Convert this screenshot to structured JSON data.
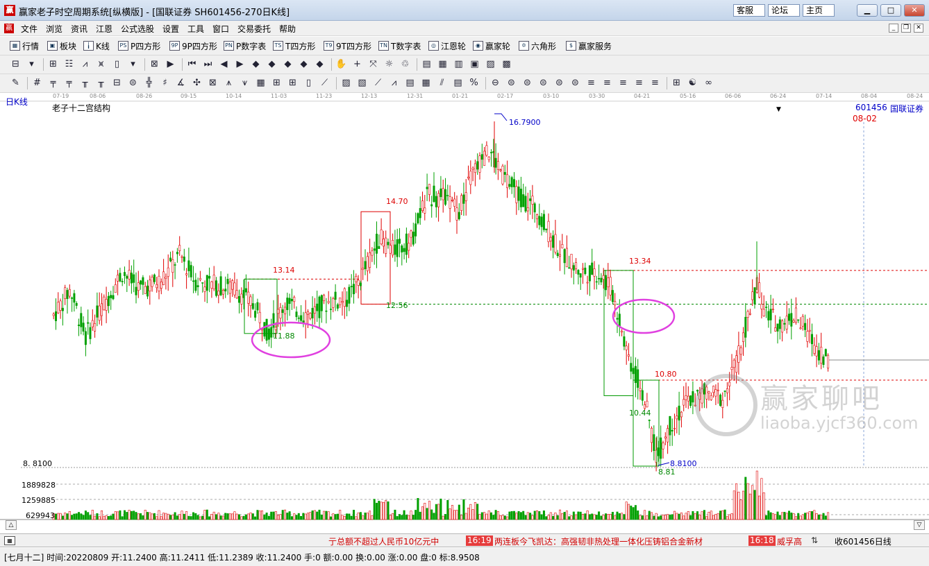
{
  "window": {
    "title": "赢家老子时空周期系统[纵横版] - [国联证券  SH601456-270日K线]",
    "links": [
      "客服",
      "论坛",
      "主页"
    ]
  },
  "menu": [
    "文件",
    "浏览",
    "资讯",
    "江恩",
    "公式选股",
    "设置",
    "工具",
    "窗口",
    "交易委托",
    "帮助"
  ],
  "toolbar1": [
    {
      "icon": "grid-icon",
      "glyph": "▦",
      "label": "行情"
    },
    {
      "icon": "blocks-icon",
      "glyph": "▣",
      "label": "板块"
    },
    {
      "icon": "candle-icon",
      "glyph": "╽",
      "label": "K线"
    },
    {
      "icon": "ps-icon",
      "glyph": "PS",
      "label": "P四方形"
    },
    {
      "icon": "9p-icon",
      "glyph": "9P",
      "label": "9P四方形"
    },
    {
      "icon": "pn-icon",
      "glyph": "PN",
      "label": "P数字表"
    },
    {
      "icon": "ts-icon",
      "glyph": "TS",
      "label": "T四方形"
    },
    {
      "icon": "9t-icon",
      "glyph": "T9",
      "label": "9T四方形"
    },
    {
      "icon": "tn-icon",
      "glyph": "TN",
      "label": "T数字表"
    },
    {
      "icon": "gann-wheel-icon",
      "glyph": "◎",
      "label": "江恩轮"
    },
    {
      "icon": "win-wheel-icon",
      "glyph": "◉",
      "label": "赢家轮"
    },
    {
      "icon": "hexagon-icon",
      "glyph": "✡",
      "label": "六角形"
    },
    {
      "icon": "dollar-icon",
      "glyph": "$",
      "label": "赢家服务"
    }
  ],
  "chart": {
    "period_label": "日K线",
    "indicator_name": "老子十二宫结构",
    "code": "601456",
    "name": "国联证券",
    "marker_date": "08-02",
    "date_ticks": [
      "07-19",
      "08-06",
      "08-26",
      "09-15",
      "10-14",
      "11-03",
      "11-23",
      "12-13",
      "12-31",
      "01-21",
      "02-17",
      "03-10",
      "03-30",
      "04-21",
      "05-16",
      "06-06",
      "06-24",
      "07-14",
      "08-04",
      "08-24"
    ],
    "high_label": "16.7900",
    "low_label": "8.8100",
    "low_axis_label": "8. 8100",
    "levels": [
      "14.70",
      "13.14",
      "13.34",
      "12.56",
      "11.88",
      "10.80",
      "10.44",
      "8.81"
    ],
    "volume_axis": [
      "1889828",
      "1259885",
      "629943"
    ],
    "watermark": {
      "cn": "赢家聊吧",
      "url": "liaoba.yjcf360.com"
    }
  },
  "chart_data": {
    "type": "candlestick",
    "title": "老子十二宫结构",
    "high": 16.79,
    "low": 8.81,
    "boxes": [
      {
        "top": 13.14,
        "bottom": 11.88,
        "color": "green"
      },
      {
        "top": 14.7,
        "bottom": 12.56,
        "color": "red"
      },
      {
        "top": 13.34,
        "bottom": 10.44,
        "color": "green"
      },
      {
        "top": 10.8,
        "bottom": 8.81,
        "color": "green"
      }
    ],
    "volume_ticks": [
      629943,
      1259885,
      1889828
    ]
  },
  "ticker": {
    "items": [
      {
        "time": "",
        "text": "亍总额不超过人民币10亿元中"
      },
      {
        "time": "16:19",
        "text": "两连板今飞凯达：高强韧非热处理一体化压铸铝合金新材"
      },
      {
        "time": "16:18",
        "text": "威孚高"
      }
    ],
    "right_label": "收601456日线"
  },
  "status": "[七月十二] 时间:20220809 开:11.2400 高:11.2411 低:11.2389 收:11.2400 手:0 额:0.00 换:0.00 涨:0.00 盘:0 标:8.9508"
}
